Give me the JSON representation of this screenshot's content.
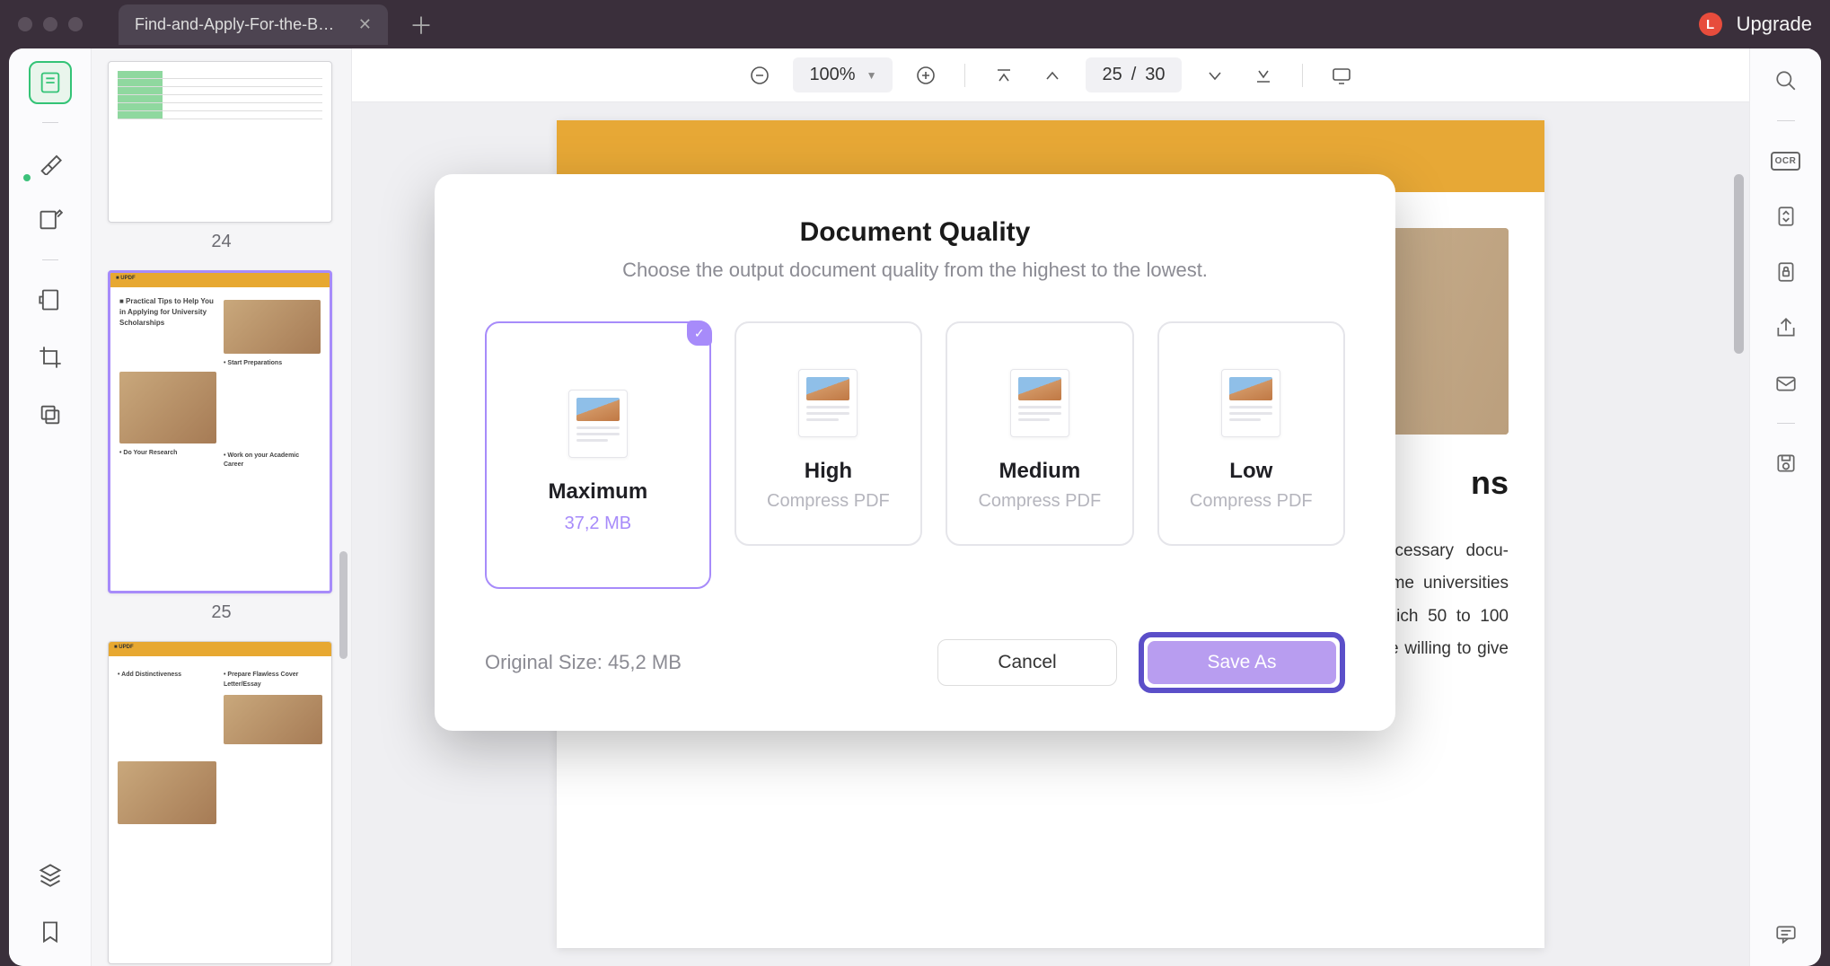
{
  "titlebar": {
    "tab_title": "Find-and-Apply-For-the-B…",
    "avatar_letter": "L",
    "upgrade_label": "Upgrade"
  },
  "toolbar": {
    "zoom_level": "100%",
    "page_current": "25",
    "page_separator": "/",
    "page_total": "30"
  },
  "thumbnails": {
    "page24_num": "24",
    "page25_num": "25"
  },
  "document": {
    "heading_fragment": "ns",
    "body_text": "…cided about a …ersity, begin the …cessary docu-mentation and certifications carefully. Some universities also offer \"scholarship weekends,\" in which 50 to 100 students come for the inter-view. If you are willing to give an interview, you"
  },
  "modal": {
    "title": "Document Quality",
    "subtitle": "Choose the output document quality from the highest to the lowest.",
    "options": [
      {
        "name": "Maximum",
        "size": "37,2 MB",
        "sub": "",
        "selected": true
      },
      {
        "name": "High",
        "size": "",
        "sub": "Compress PDF",
        "selected": false
      },
      {
        "name": "Medium",
        "size": "",
        "sub": "Compress PDF",
        "selected": false
      },
      {
        "name": "Low",
        "size": "",
        "sub": "Compress PDF",
        "selected": false
      }
    ],
    "original_size": "Original Size: 45,2 MB",
    "cancel_label": "Cancel",
    "save_label": "Save As"
  },
  "right_sidebar": {
    "ocr_label": "OCR"
  }
}
